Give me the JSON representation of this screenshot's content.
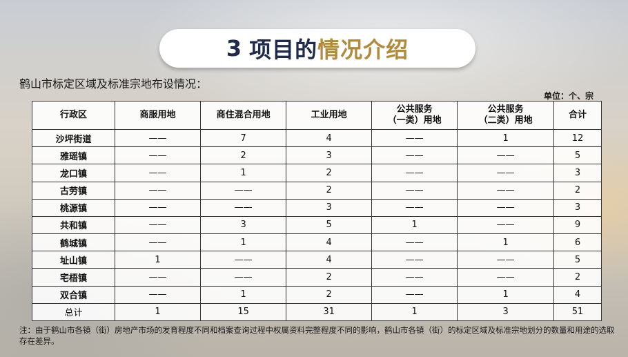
{
  "title": {
    "num": "3",
    "dark": "项目的",
    "gold": "情况介绍"
  },
  "subtitle": "鹤山市标定区域及标准宗地布设情况：",
  "unit": "单位：个、宗",
  "table": {
    "headers": [
      [
        "行政区"
      ],
      [
        "商服用地"
      ],
      [
        "商住混合用地"
      ],
      [
        "工业用地"
      ],
      [
        "公共服务",
        "（一类）用地"
      ],
      [
        "公共服务",
        "（二类）用地"
      ],
      [
        "合计"
      ]
    ],
    "rows": [
      [
        "沙坪街道",
        "——",
        "7",
        "4",
        "——",
        "1",
        "12"
      ],
      [
        "雅瑶镇",
        "——",
        "2",
        "3",
        "——",
        "——",
        "5"
      ],
      [
        "龙口镇",
        "——",
        "1",
        "2",
        "——",
        "——",
        "3"
      ],
      [
        "古劳镇",
        "——",
        "——",
        "2",
        "——",
        "——",
        "2"
      ],
      [
        "桃源镇",
        "——",
        "——",
        "3",
        "——",
        "——",
        "3"
      ],
      [
        "共和镇",
        "——",
        "3",
        "5",
        "1",
        "——",
        "9"
      ],
      [
        "鹤城镇",
        "——",
        "1",
        "4",
        "——",
        "1",
        "6"
      ],
      [
        "址山镇",
        "1",
        "——",
        "4",
        "——",
        "——",
        "5"
      ],
      [
        "宅梧镇",
        "——",
        "——",
        "2",
        "——",
        "——",
        "2"
      ],
      [
        "双合镇",
        "——",
        "1",
        "2",
        "——",
        "1",
        "4"
      ],
      [
        "总计",
        "1",
        "15",
        "31",
        "1",
        "3",
        "51"
      ]
    ]
  },
  "note": "注：由于鹤山市各镇（街）房地产市场的发育程度不同和档案查询过程中权属资料完整程度不同的影响，鹤山市各镇（街）的标定区域及标准宗地划分的数量和用途的选取存在差异。"
}
